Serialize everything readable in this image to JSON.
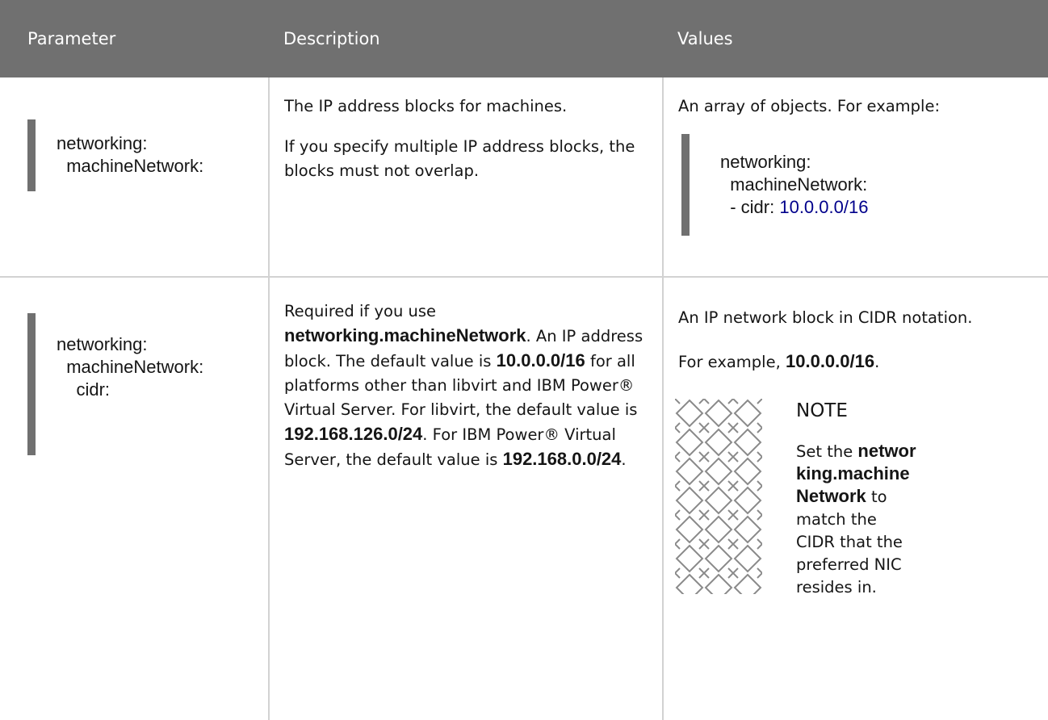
{
  "table": {
    "headers": [
      "Parameter",
      "Description",
      "Values"
    ],
    "row1": {
      "param_lines": [
        "networking:",
        "  machineNetwork:"
      ],
      "desc_p1": "The IP address blocks for machines.",
      "desc_p2": "If you specify multiple IP address blocks, the blocks must not overlap.",
      "values_intro": "An array of objects. For example:",
      "values_code": {
        "line1": "networking:",
        "line2": "  machineNetwork:",
        "line3_prefix": "  - cidr: ",
        "line3_value": "10.0.0.0/16"
      }
    },
    "row2": {
      "param_lines": [
        "networking:",
        "  machineNetwork:",
        "    cidr:"
      ],
      "desc": {
        "t1": "Required if you use ",
        "b1": "networking.machineNetwork",
        "t2": ". An IP address block. The default value is ",
        "b2": "10.0.0.0/16",
        "t3": " for all platforms other than libvirt and IBM Power® Virtual Server. For libvirt, the default value is ",
        "b3": "192.168.126.0/24",
        "t4": ". For IBM Power® Virtual Server, the default value is ",
        "b4": "192.168.0.0/24",
        "t5": "."
      },
      "values_p1": "An IP network block in CIDR notation.",
      "values_p2_text": "For example, ",
      "values_p2_bold": "10.0.0.0/16",
      "values_p2_end": ".",
      "note": {
        "title": "NOTE",
        "t1": "Set the ",
        "b1": "networking.machineNetwork",
        "t2": " to match the CIDR that the preferred NIC resides in."
      }
    }
  }
}
